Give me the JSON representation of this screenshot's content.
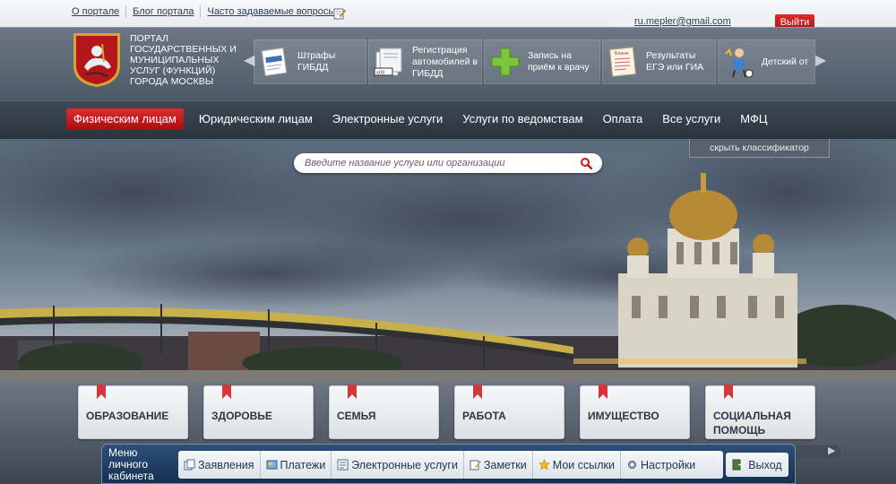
{
  "top_links": [
    "О портале",
    "Блог портала",
    "Часто задаваемые вопросы"
  ],
  "user": {
    "email": "ru.mepler@gmail.com",
    "logout_label": "Выйти"
  },
  "header": {
    "portal_title": "Портал государственных и муниципальных услуг (функций) города Москвы"
  },
  "services": [
    {
      "label": "Штрафы ГИБДД",
      "icon": "fine-document-icon"
    },
    {
      "label": "Регистрация автомобилей в ГИБДД",
      "icon": "car-registration-icon"
    },
    {
      "label": "Запись на приём к врачу",
      "icon": "medical-cross-icon"
    },
    {
      "label": "Результаты ЕГЭ или ГИА",
      "icon": "exam-form-icon"
    },
    {
      "label": "Детский от",
      "icon": "child-leisure-icon"
    }
  ],
  "nav": [
    "Физическим лицам",
    "Юридическим лицам",
    "Электронные услуги",
    "Услуги по ведомствам",
    "Оплата",
    "Все услуги",
    "МФЦ"
  ],
  "classifier": {
    "hide_label": "скрыть классификатор"
  },
  "search": {
    "placeholder": "Введите название услуги или организации"
  },
  "categories": [
    "Образование",
    "Здоровье",
    "Семья",
    "Работа",
    "Имущество",
    "Социальная помощь"
  ],
  "dock": {
    "label": "Меню личного кабинета",
    "items": [
      {
        "label": "Заявления",
        "icon": "applications-icon"
      },
      {
        "label": "Платежи",
        "icon": "payments-icon"
      },
      {
        "label": "Электронные услуги",
        "icon": "e-services-icon"
      },
      {
        "label": "Заметки",
        "icon": "notes-icon"
      },
      {
        "label": "Мои ссылки",
        "icon": "star-icon"
      },
      {
        "label": "Настройки",
        "icon": "settings-icon"
      }
    ],
    "exit_label": "Выход"
  },
  "colors": {
    "accent_red": "#c8161c",
    "dock_blue": "#1f3d63",
    "header_gray": "#5a6673"
  }
}
